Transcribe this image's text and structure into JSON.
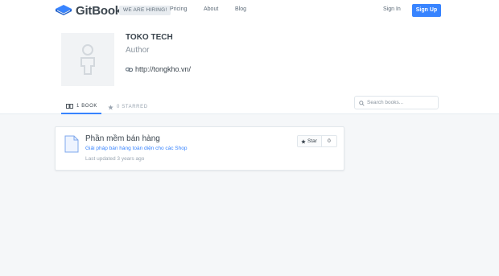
{
  "header": {
    "logo_text": "GitBook",
    "hiring_badge": "WE ARE HIRING!",
    "nav": [
      "Pricing",
      "About",
      "Blog"
    ],
    "signin_label": "Sign In",
    "signup_label": "Sign Up"
  },
  "profile": {
    "name": "TOKO TECH",
    "role": "Author",
    "website": "http://tongkho.vn/"
  },
  "tabs": [
    {
      "label": "1 BOOK",
      "icon": "book-icon",
      "active": true
    },
    {
      "label": "0 STARRED",
      "icon": "star-icon",
      "active": false
    }
  ],
  "search": {
    "placeholder": "Search books..."
  },
  "books": [
    {
      "title": "Phần mềm bán hàng",
      "description": "Giải pháp bán hàng toàn diện cho các Shop",
      "updated": "Last updated 3 years ago",
      "star_label": "Star",
      "star_count": "0"
    }
  ],
  "colors": {
    "accent": "#3884ff",
    "text_dark": "#3b454e",
    "muted": "#9aa5b1",
    "background": "#f5f7f9"
  }
}
